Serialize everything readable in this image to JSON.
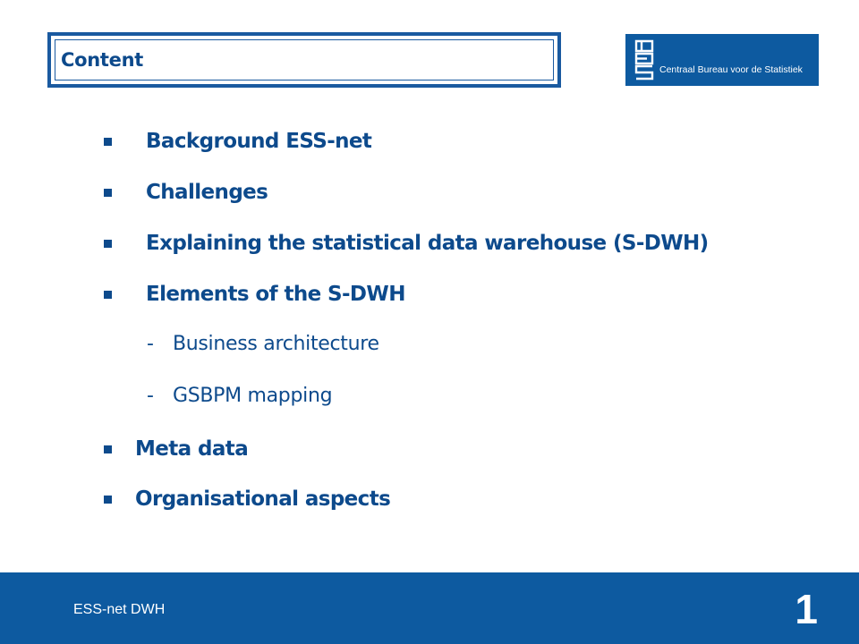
{
  "header": {
    "title": "Content"
  },
  "logo": {
    "icon": "cbs-logo-icon",
    "text": "Centraal Bureau voor de Statistiek"
  },
  "items": [
    {
      "text": "Background ESS-net",
      "level": 1
    },
    {
      "text": "Challenges",
      "level": 1
    },
    {
      "text": "Explaining the statistical data warehouse (S-DWH)",
      "level": 1
    },
    {
      "text": "Elements of the S-DWH",
      "level": 1
    },
    {
      "text": "Business architecture",
      "level": 2
    },
    {
      "text": "GSBPM mapping",
      "level": 2
    },
    {
      "text": "Meta data",
      "level": 1
    },
    {
      "text": "Organisational aspects",
      "level": 1
    }
  ],
  "sub_marker": "-",
  "footer": {
    "label": "ESS-net DWH",
    "page_number": "1"
  },
  "colors": {
    "primary": "#0d5aa0",
    "text": "#0d4a8c",
    "background": "#ffffff"
  }
}
